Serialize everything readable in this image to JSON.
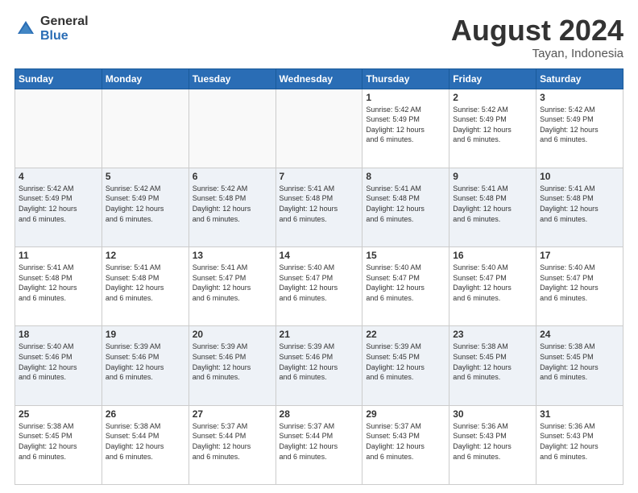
{
  "header": {
    "logo_general": "General",
    "logo_blue": "Blue",
    "month_title": "August 2024",
    "location": "Tayan, Indonesia"
  },
  "weekdays": [
    "Sunday",
    "Monday",
    "Tuesday",
    "Wednesday",
    "Thursday",
    "Friday",
    "Saturday"
  ],
  "weeks": [
    [
      {
        "day": "",
        "info": ""
      },
      {
        "day": "",
        "info": ""
      },
      {
        "day": "",
        "info": ""
      },
      {
        "day": "",
        "info": ""
      },
      {
        "day": "1",
        "info": "Sunrise: 5:42 AM\nSunset: 5:49 PM\nDaylight: 12 hours\nand 6 minutes."
      },
      {
        "day": "2",
        "info": "Sunrise: 5:42 AM\nSunset: 5:49 PM\nDaylight: 12 hours\nand 6 minutes."
      },
      {
        "day": "3",
        "info": "Sunrise: 5:42 AM\nSunset: 5:49 PM\nDaylight: 12 hours\nand 6 minutes."
      }
    ],
    [
      {
        "day": "4",
        "info": "Sunrise: 5:42 AM\nSunset: 5:49 PM\nDaylight: 12 hours\nand 6 minutes."
      },
      {
        "day": "5",
        "info": "Sunrise: 5:42 AM\nSunset: 5:49 PM\nDaylight: 12 hours\nand 6 minutes."
      },
      {
        "day": "6",
        "info": "Sunrise: 5:42 AM\nSunset: 5:48 PM\nDaylight: 12 hours\nand 6 minutes."
      },
      {
        "day": "7",
        "info": "Sunrise: 5:41 AM\nSunset: 5:48 PM\nDaylight: 12 hours\nand 6 minutes."
      },
      {
        "day": "8",
        "info": "Sunrise: 5:41 AM\nSunset: 5:48 PM\nDaylight: 12 hours\nand 6 minutes."
      },
      {
        "day": "9",
        "info": "Sunrise: 5:41 AM\nSunset: 5:48 PM\nDaylight: 12 hours\nand 6 minutes."
      },
      {
        "day": "10",
        "info": "Sunrise: 5:41 AM\nSunset: 5:48 PM\nDaylight: 12 hours\nand 6 minutes."
      }
    ],
    [
      {
        "day": "11",
        "info": "Sunrise: 5:41 AM\nSunset: 5:48 PM\nDaylight: 12 hours\nand 6 minutes."
      },
      {
        "day": "12",
        "info": "Sunrise: 5:41 AM\nSunset: 5:48 PM\nDaylight: 12 hours\nand 6 minutes."
      },
      {
        "day": "13",
        "info": "Sunrise: 5:41 AM\nSunset: 5:47 PM\nDaylight: 12 hours\nand 6 minutes."
      },
      {
        "day": "14",
        "info": "Sunrise: 5:40 AM\nSunset: 5:47 PM\nDaylight: 12 hours\nand 6 minutes."
      },
      {
        "day": "15",
        "info": "Sunrise: 5:40 AM\nSunset: 5:47 PM\nDaylight: 12 hours\nand 6 minutes."
      },
      {
        "day": "16",
        "info": "Sunrise: 5:40 AM\nSunset: 5:47 PM\nDaylight: 12 hours\nand 6 minutes."
      },
      {
        "day": "17",
        "info": "Sunrise: 5:40 AM\nSunset: 5:47 PM\nDaylight: 12 hours\nand 6 minutes."
      }
    ],
    [
      {
        "day": "18",
        "info": "Sunrise: 5:40 AM\nSunset: 5:46 PM\nDaylight: 12 hours\nand 6 minutes."
      },
      {
        "day": "19",
        "info": "Sunrise: 5:39 AM\nSunset: 5:46 PM\nDaylight: 12 hours\nand 6 minutes."
      },
      {
        "day": "20",
        "info": "Sunrise: 5:39 AM\nSunset: 5:46 PM\nDaylight: 12 hours\nand 6 minutes."
      },
      {
        "day": "21",
        "info": "Sunrise: 5:39 AM\nSunset: 5:46 PM\nDaylight: 12 hours\nand 6 minutes."
      },
      {
        "day": "22",
        "info": "Sunrise: 5:39 AM\nSunset: 5:45 PM\nDaylight: 12 hours\nand 6 minutes."
      },
      {
        "day": "23",
        "info": "Sunrise: 5:38 AM\nSunset: 5:45 PM\nDaylight: 12 hours\nand 6 minutes."
      },
      {
        "day": "24",
        "info": "Sunrise: 5:38 AM\nSunset: 5:45 PM\nDaylight: 12 hours\nand 6 minutes."
      }
    ],
    [
      {
        "day": "25",
        "info": "Sunrise: 5:38 AM\nSunset: 5:45 PM\nDaylight: 12 hours\nand 6 minutes."
      },
      {
        "day": "26",
        "info": "Sunrise: 5:38 AM\nSunset: 5:44 PM\nDaylight: 12 hours\nand 6 minutes."
      },
      {
        "day": "27",
        "info": "Sunrise: 5:37 AM\nSunset: 5:44 PM\nDaylight: 12 hours\nand 6 minutes."
      },
      {
        "day": "28",
        "info": "Sunrise: 5:37 AM\nSunset: 5:44 PM\nDaylight: 12 hours\nand 6 minutes."
      },
      {
        "day": "29",
        "info": "Sunrise: 5:37 AM\nSunset: 5:43 PM\nDaylight: 12 hours\nand 6 minutes."
      },
      {
        "day": "30",
        "info": "Sunrise: 5:36 AM\nSunset: 5:43 PM\nDaylight: 12 hours\nand 6 minutes."
      },
      {
        "day": "31",
        "info": "Sunrise: 5:36 AM\nSunset: 5:43 PM\nDaylight: 12 hours\nand 6 minutes."
      }
    ]
  ]
}
